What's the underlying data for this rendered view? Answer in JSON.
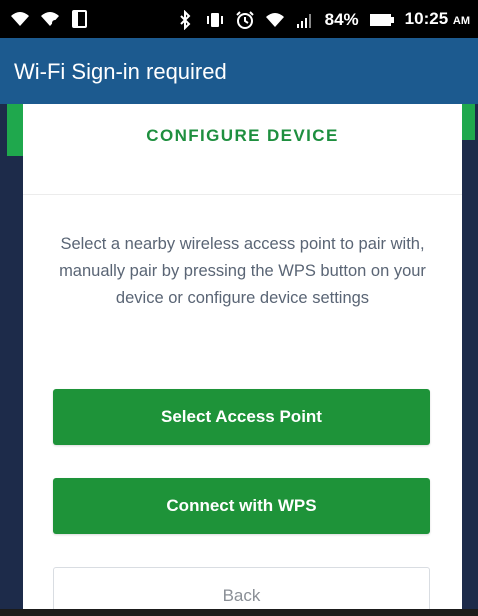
{
  "status_bar": {
    "icons": [
      "wifi-call-icon",
      "wifi-icon",
      "tablet-icon",
      "bluetooth-icon",
      "vibrate-icon",
      "alarm-icon",
      "wifi-signal-icon",
      "cell-signal-icon",
      "battery-icon"
    ],
    "battery": "84%",
    "time": "10:25",
    "ampm": "AM"
  },
  "title_bar": {
    "title": "Wi-Fi Sign-in required"
  },
  "card": {
    "header": "CONFIGURE DEVICE",
    "description": "Select a nearby wireless access point to pair with, manually pair by pressing the WPS button on your device or configure device settings",
    "buttons": {
      "select_access_point": "Select Access Point",
      "connect_wps": "Connect with WPS",
      "back": "Back"
    }
  },
  "colors": {
    "title_bar": "#1c5a8f",
    "accent_green": "#1e9339",
    "header_green": "#1e8f3f",
    "background_navy": "#1d2b4a"
  }
}
